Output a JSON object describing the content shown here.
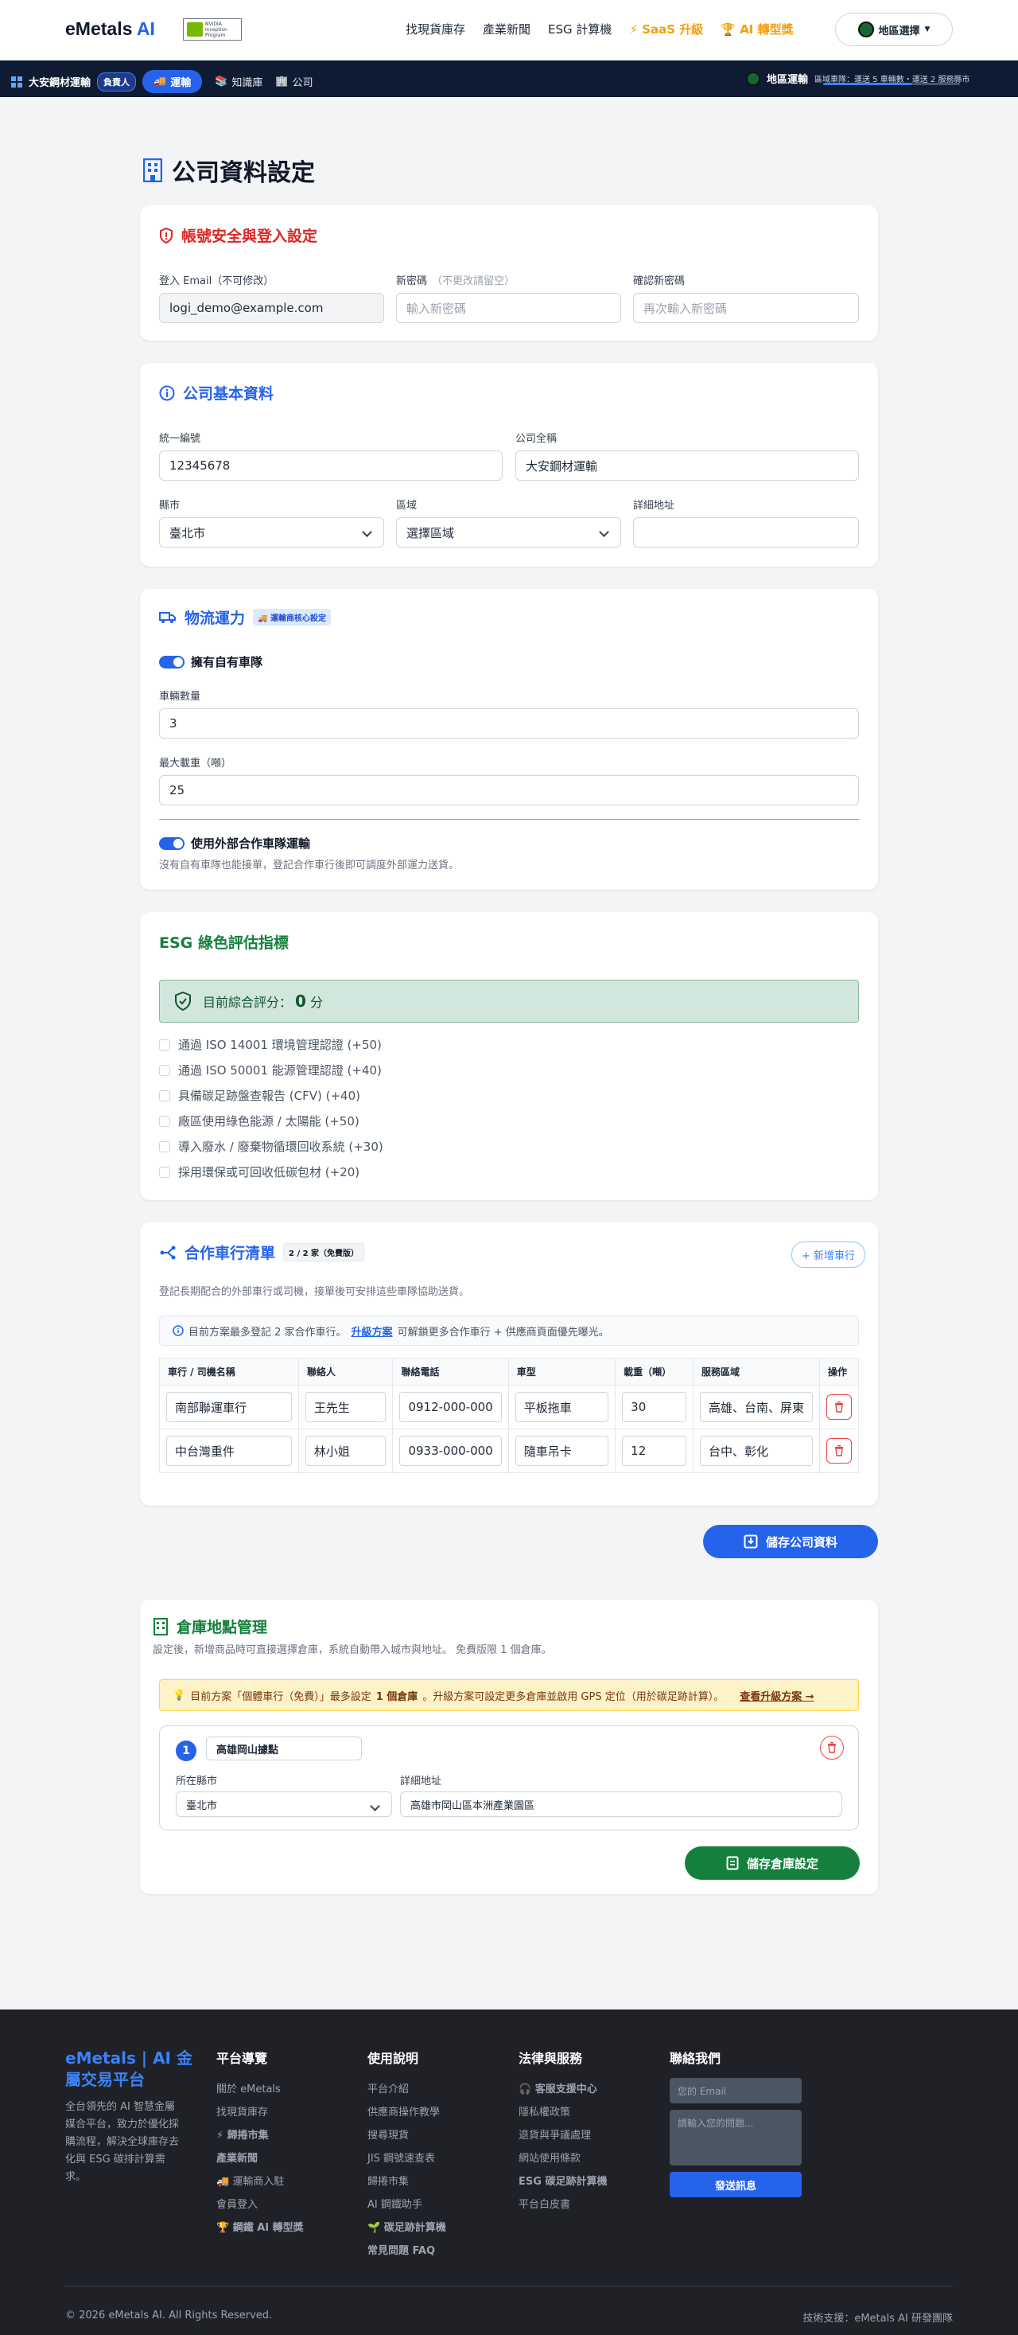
{
  "header": {
    "brand_name": "eMetals",
    "brand_ai": "AI",
    "badge_line1": "NVIDIA",
    "badge_line2": "Inception",
    "badge_line3": "Program",
    "nav": [
      "找現貨庫存",
      "產業新聞",
      "ESG 計算機",
      "SaaS 升級",
      "AI 轉型獎"
    ],
    "region_label": "地區選擇"
  },
  "subbar": {
    "company": "大安鋼材運輸",
    "role": "負責人",
    "tab_active": "運輸",
    "tab_kb": "知識庫",
    "tab_company": "公司",
    "region_title": "地區運輸",
    "region_text": "區域車隊：運送 5 車輛數・運送 2 服務縣市"
  },
  "page": {
    "title": "公司資料設定"
  },
  "account": {
    "title": "帳號安全與登入設定",
    "email_label": "登入 Email（不可修改）",
    "email_value": "logi_demo@example.com",
    "new_pw_label": "新密碼",
    "new_pw_hint": "（不更改請留空）",
    "new_pw_placeholder": "輸入新密碼",
    "confirm_pw_label": "確認新密碼",
    "confirm_pw_placeholder": "再次輸入新密碼"
  },
  "company": {
    "title": "公司基本資料",
    "tax_label": "統一編號",
    "tax_value": "12345678",
    "name_label": "公司全稱",
    "name_value": "大安鋼材運輸",
    "city_label": "縣市",
    "city_value": "臺北市",
    "district_label": "區域",
    "district_value": "選擇區域",
    "address_label": "詳細地址",
    "address_value": ""
  },
  "logistics": {
    "title": "物流運力",
    "tag": "運輸商核心設定",
    "own_fleet_label": "擁有自有車隊",
    "own_fleet_on": true,
    "vehicles_label": "車輛數量",
    "vehicles_value": "3",
    "max_load_label": "最大載重（噸）",
    "max_load_value": "25",
    "external_label": "使用外部合作車隊運輸",
    "external_on": true,
    "external_hint": "沒有自有車隊也能接單，登記合作車行後即可調度外部運力送貨。"
  },
  "esg": {
    "title": "ESG 綠色評估指標",
    "score_prefix": "目前綜合評分：",
    "score_value": "0",
    "score_unit": "分",
    "items": [
      "通過 ISO 14001 環境管理認證 (+50)",
      "通過 ISO 50001 能源管理認證 (+40)",
      "具備碳足跡盤查報告 (CFV) (+40)",
      "廠區使用綠色能源 / 太陽能 (+50)",
      "導入廢水 / 廢棄物循環回收系統 (+30)",
      "採用環保或可回收低碳包材 (+20)"
    ]
  },
  "partners": {
    "title": "合作車行清單",
    "count_tag": "2 / 2 家（免費版）",
    "add_button": "+ 新增車行",
    "desc": "登記長期配合的外部車行或司機，接單後可安排這些車隊協助送貨。",
    "info_prefix": "目前方案最多登記 2 家合作車行。",
    "info_link": "升級方案",
    "info_suffix": "可解鎖更多合作車行 + 供應商頁面優先曝光。",
    "columns": [
      "車行 / 司機名稱",
      "聯絡人",
      "聯絡電話",
      "車型",
      "載重（噸）",
      "服務區域",
      "操作"
    ],
    "rows": [
      {
        "name": "南部聯運車行",
        "contact": "王先生",
        "phone": "0912-000-000",
        "vehicle": "平板拖車",
        "load": "30",
        "area": "高雄、台南、屏東"
      },
      {
        "name": "中台灣重件",
        "contact": "林小姐",
        "phone": "0933-000-000",
        "vehicle": "隨車吊卡",
        "load": "12",
        "area": "台中、彰化"
      }
    ]
  },
  "save_company_button": "儲存公司資料",
  "warehouse": {
    "title": "倉庫地點管理",
    "desc": "設定後，新增商品時可直接選擇倉庫，系統自動帶入城市與地址。 免費版限 1 個倉庫。",
    "warn_prefix": "目前方案「個體車行（免費）」最多設定",
    "warn_bold": "1 個倉庫",
    "warn_suffix": "。升級方案可設定更多倉庫並啟用 GPS 定位（用於碳足跡計算）。",
    "warn_link": "查看升級方案 →",
    "item_number": "1",
    "item_name": "高雄岡山據點",
    "city_label": "所在縣市",
    "city_value": "臺北市",
    "address_label": "詳細地址",
    "address_value": "高雄市岡山區本洲產業園區",
    "save_button": "儲存倉庫設定"
  },
  "footer": {
    "brand": "eMetals | AI 金屬交易平台",
    "desc": "全台領先的 AI 智慧金屬媒合平台，致力於優化採購流程，解決全球庫存去化與 ESG 碳排計算需求。",
    "col1_title": "平台導覽",
    "col1": [
      "關於 eMetals",
      "找現貨庫存",
      "歸捲市集",
      "產業新聞",
      "運輸商入駐",
      "會員登入",
      "鋼鐵 AI 轉型獎"
    ],
    "col2_title": "使用說明",
    "col2": [
      "平台介紹",
      "供應商操作教學",
      "搜尋現貨",
      "JIS 鋼號速查表",
      "歸捲市集",
      "AI 鋼鐵助手",
      "碳足跡計算機",
      "常見問題 FAQ"
    ],
    "col3_title": "法律與服務",
    "col3": [
      "客服支援中心",
      "隱私權政策",
      "退貨與爭議處理",
      "網站使用條款",
      "ESG 碳足跡計算機",
      "平台白皮書"
    ],
    "col4_title": "聯絡我們",
    "email_placeholder": "您的 Email",
    "message_placeholder": "請輸入您的問題...",
    "send_button": "發送訊息",
    "copyright": "© 2026 eMetals AI. All Rights Reserved.",
    "tech": "技術支援：eMetals AI 研發團隊"
  },
  "colors": {
    "primary": "#2563eb",
    "danger": "#dc2626",
    "success": "#15803d",
    "gold": "#f59e0b",
    "dark": "#0f1b33"
  }
}
